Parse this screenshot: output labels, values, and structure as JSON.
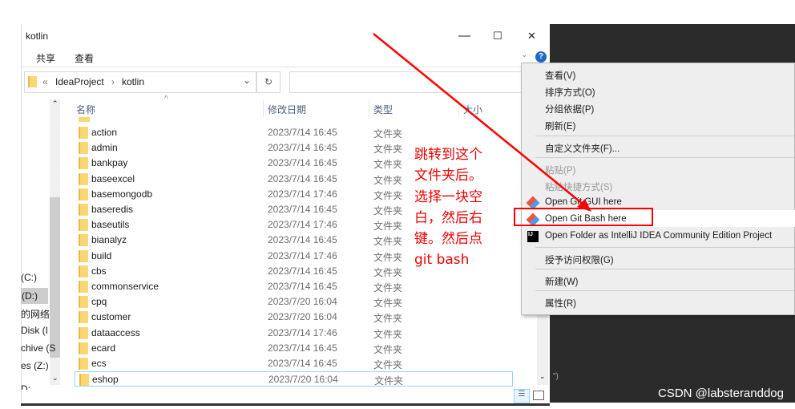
{
  "window": {
    "title": "kotlin",
    "minimize": "—",
    "maximize": "☐",
    "close": "✕",
    "help": "?"
  },
  "ribbon": {
    "tabs": [
      "共享",
      "查看"
    ]
  },
  "address": {
    "prefix": "«",
    "path": [
      "IdeaProject",
      "kotlin"
    ],
    "separator": "›",
    "refresh": "↻"
  },
  "columns": {
    "name": "名称",
    "modified": "修改日期",
    "type": "类型",
    "size": "大小"
  },
  "nav": [
    "(C:)",
    "(D:)",
    "的网络",
    "Disk (I",
    "chive (S",
    "es (Z:)",
    "D:"
  ],
  "files": [
    {
      "name": "action",
      "date": "2023/7/14 16:45",
      "type": "文件夹"
    },
    {
      "name": "admin",
      "date": "2023/7/14 16:45",
      "type": "文件夹"
    },
    {
      "name": "bankpay",
      "date": "2023/7/14 16:45",
      "type": "文件夹"
    },
    {
      "name": "baseexcel",
      "date": "2023/7/14 16:45",
      "type": "文件夹"
    },
    {
      "name": "basemongodb",
      "date": "2023/7/14 17:46",
      "type": "文件夹"
    },
    {
      "name": "baseredis",
      "date": "2023/7/14 16:45",
      "type": "文件夹"
    },
    {
      "name": "baseutils",
      "date": "2023/7/14 17:46",
      "type": "文件夹"
    },
    {
      "name": "bianalyz",
      "date": "2023/7/14 16:45",
      "type": "文件夹"
    },
    {
      "name": "build",
      "date": "2023/7/14 17:46",
      "type": "文件夹"
    },
    {
      "name": "cbs",
      "date": "2023/7/14 16:45",
      "type": "文件夹"
    },
    {
      "name": "commonservice",
      "date": "2023/7/14 16:45",
      "type": "文件夹"
    },
    {
      "name": "cpq",
      "date": "2023/7/20 16:04",
      "type": "文件夹"
    },
    {
      "name": "customer",
      "date": "2023/7/20 16:04",
      "type": "文件夹"
    },
    {
      "name": "dataaccess",
      "date": "2023/7/14 17:46",
      "type": "文件夹"
    },
    {
      "name": "ecard",
      "date": "2023/7/14 16:45",
      "type": "文件夹"
    },
    {
      "name": "ecs",
      "date": "2023/7/14 16:45",
      "type": "文件夹"
    },
    {
      "name": "eshop",
      "date": "2023/7/20 16:04",
      "type": "文件夹"
    }
  ],
  "context_menu": {
    "items": [
      "查看(V)",
      "排序方式(O)",
      "分组依据(P)",
      "刷新(E)",
      "自定义文件夹(F)...",
      "粘贴(P)",
      "粘贴快捷方式(S)",
      "Open Git GUI here",
      "Open Git Bash here",
      "Open Folder as IntelliJ IDEA Community Edition Project",
      "授予访问权限(G)",
      "新建(W)",
      "属性(R)"
    ],
    "highlighted": "Open Git Bash here"
  },
  "annotation": {
    "lines": [
      "跳转到这个",
      "文件夹后。",
      "选择一块空",
      "白，然后右",
      "键。然后点",
      "git bash"
    ],
    "color": "#ff0000"
  },
  "watermark": "CSDN @labsteranddog"
}
